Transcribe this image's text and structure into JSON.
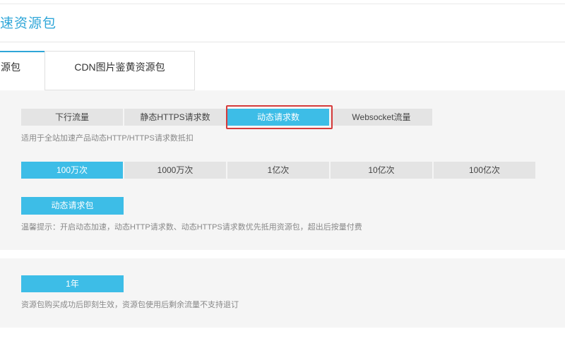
{
  "page": {
    "title": "速资源包"
  },
  "tabs": [
    {
      "label": "源包"
    },
    {
      "label": "CDN图片鉴黄资源包"
    }
  ],
  "request_types": [
    {
      "label": "下行流量"
    },
    {
      "label": "静态HTTPS请求数"
    },
    {
      "label": "动态请求数"
    },
    {
      "label": "Websocket流量"
    }
  ],
  "request_types_desc": "适用于全站加速产品动态HTTP/HTTPS请求数抵扣",
  "amounts": [
    {
      "label": "100万次"
    },
    {
      "label": "1000万次"
    },
    {
      "label": "1亿次"
    },
    {
      "label": "10亿次"
    },
    {
      "label": "100亿次"
    }
  ],
  "package_button": "动态请求包",
  "tip": "温馨提示：开启动态加速，动态HTTP请求数、动态HTTPS请求数优先抵用资源包，超出后按量付费",
  "duration_button": "1年",
  "duration_desc": "资源包购买成功后即刻生效，资源包使用后剩余流量不支持退订",
  "colors": {
    "accent": "#3dbde7",
    "title": "#2fa6d8",
    "highlight": "#d63b3b"
  }
}
